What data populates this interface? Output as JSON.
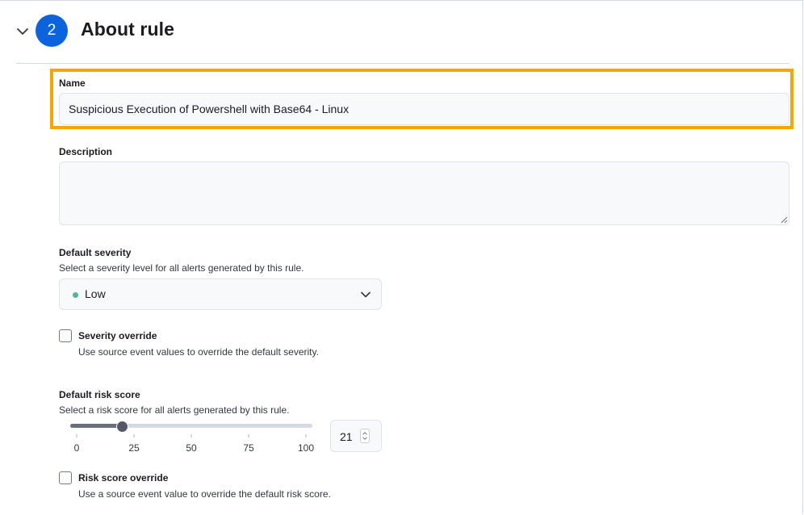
{
  "step": {
    "number": "2",
    "title": "About rule"
  },
  "name_field": {
    "label": "Name",
    "value": "Suspicious Execution of Powershell with Base64 - Linux"
  },
  "description_field": {
    "label": "Description",
    "value": ""
  },
  "default_severity": {
    "label": "Default severity",
    "help": "Select a severity level for all alerts generated by this rule.",
    "selected": "Low",
    "dot_color": "#54b399"
  },
  "severity_override": {
    "label": "Severity override",
    "help": "Use source event values to override the default severity.",
    "checked": false
  },
  "default_risk_score": {
    "label": "Default risk score",
    "help": "Select a risk score for all alerts generated by this rule.",
    "value": "21",
    "min": 0,
    "max": 100,
    "ticks": [
      "0",
      "25",
      "50",
      "75",
      "100"
    ]
  },
  "risk_score_override": {
    "label": "Risk score override",
    "help": "Use a source event value to override the default risk score.",
    "checked": false
  },
  "colors": {
    "accent": "#0b64dd",
    "highlight": "#f5a700"
  }
}
